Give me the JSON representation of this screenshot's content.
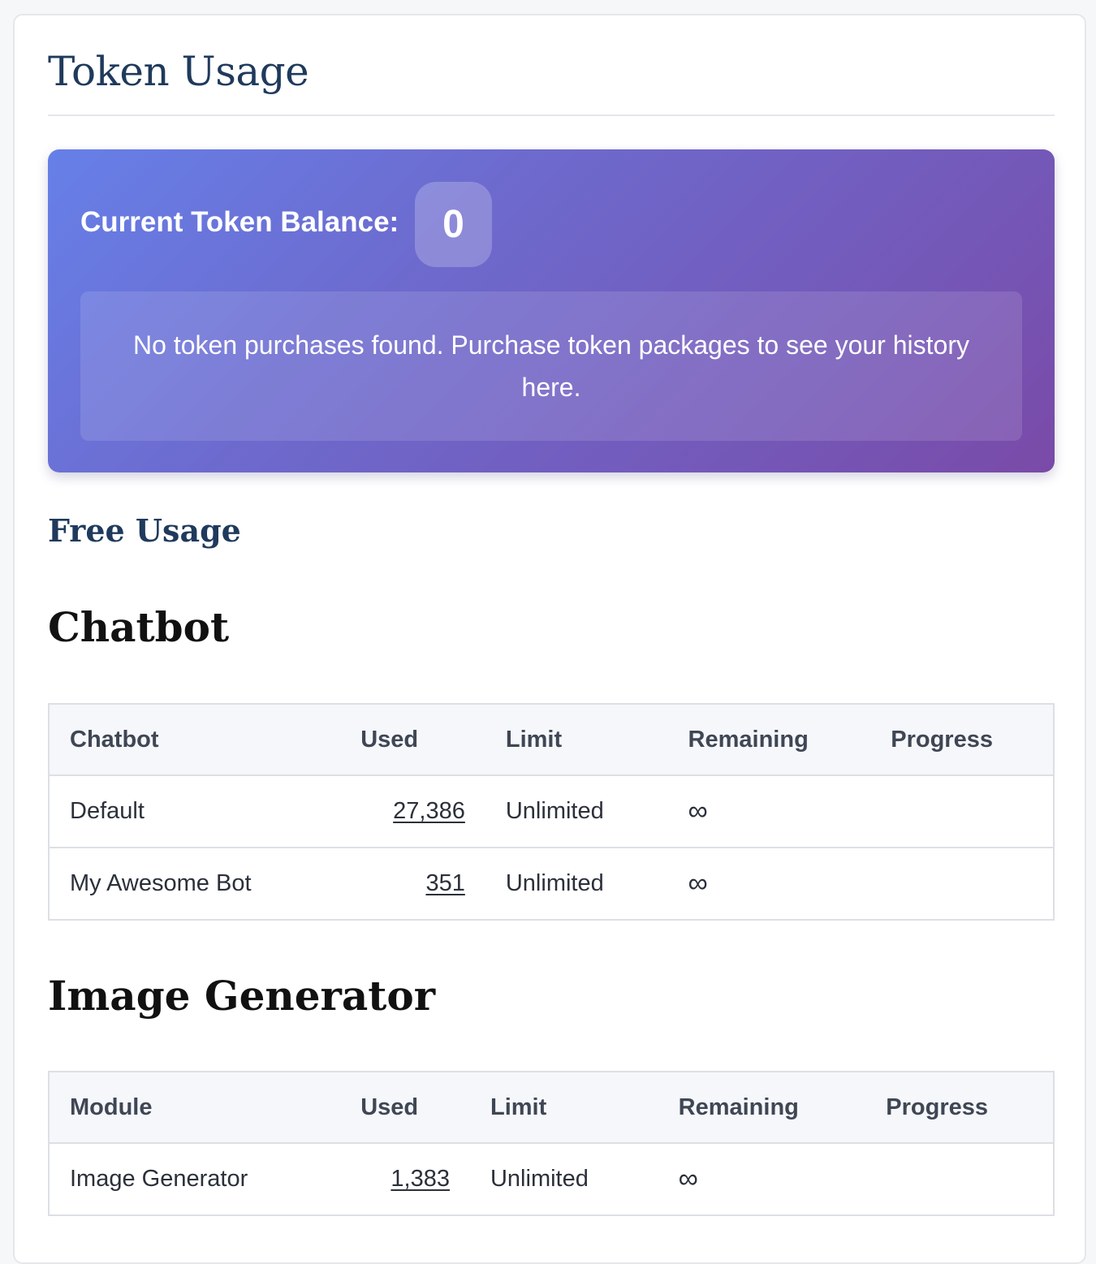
{
  "page": {
    "title": "Token Usage"
  },
  "balance": {
    "label": "Current Token Balance:",
    "value": "0",
    "notice": "No token purchases found. Purchase token packages to see your history here."
  },
  "free_usage": {
    "title": "Free Usage"
  },
  "chatbot": {
    "title": "Chatbot",
    "headers": [
      "Chatbot",
      "Used",
      "Limit",
      "Remaining",
      "Progress"
    ],
    "rows": [
      {
        "name": "Default",
        "used": "27,386",
        "limit": "Unlimited",
        "remaining": "∞",
        "progress": ""
      },
      {
        "name": "My Awesome Bot",
        "used": "351",
        "limit": "Unlimited",
        "remaining": "∞",
        "progress": ""
      }
    ]
  },
  "image_generator": {
    "title": "Image Generator",
    "headers": [
      "Module",
      "Used",
      "Limit",
      "Remaining",
      "Progress"
    ],
    "rows": [
      {
        "name": "Image Generator",
        "used": "1,383",
        "limit": "Unlimited",
        "remaining": "∞",
        "progress": ""
      }
    ]
  },
  "colors": {
    "title": "#1f3a5c",
    "panel_gradient_start": "#6680e8",
    "panel_gradient_end": "#7a4aa8"
  }
}
